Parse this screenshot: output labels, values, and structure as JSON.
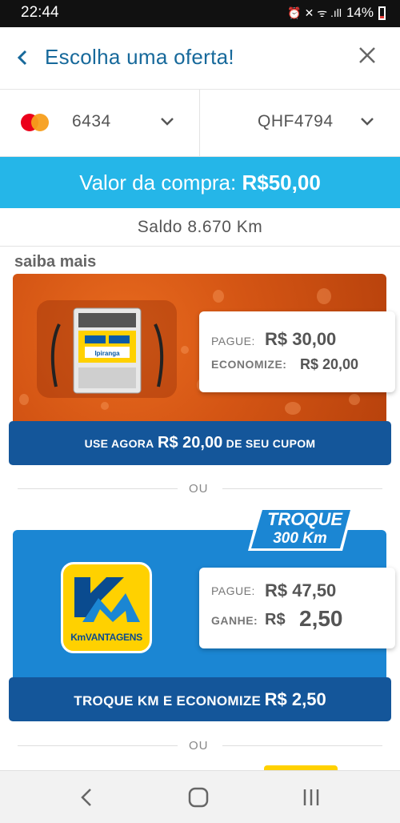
{
  "status": {
    "time": "22:44",
    "icons": "⏰ ✕ ᯤ .ıll",
    "battery": "14%"
  },
  "header": {
    "back_icon": "chevron-left-icon",
    "title": "Escolha uma oferta!",
    "close_icon": "close-icon"
  },
  "selectors": {
    "card_last_digits": "6434",
    "plate": "QHF4794"
  },
  "purchase": {
    "label": "Valor da compra:",
    "value": "R$50,00"
  },
  "balance": {
    "text": "Saldo 8.670 Km"
  },
  "saiba_mais": "saiba mais",
  "offer1": {
    "brand_label_1": "Ipiranga",
    "pague_label": "PAGUE:",
    "pague_value": "R$ 30,00",
    "economize_label": "ECONOMIZE:",
    "economize_value": "R$ 20,00",
    "cta_prefix": "USE AGORA",
    "cta_amount": "R$ 20,00",
    "cta_suffix": "DE SEU CUPOM"
  },
  "separator": "OU",
  "offer2": {
    "badge_line1": "TROQUE",
    "badge_line2": "300 Km",
    "logo_text": "KmVANTAGENS",
    "pague_label": "PAGUE:",
    "pague_value": "R$ 47,50",
    "ganhe_label": "GANHE:",
    "ganhe_currency": "R$",
    "ganhe_value": "2,50",
    "cta_prefix": "TROQUE KM E ECONOMIZE",
    "cta_amount": "R$ 2,50"
  },
  "colors": {
    "primary": "#17699b",
    "accent": "#25b6e8",
    "cta": "#14569a",
    "offer_blue": "#1b86d3",
    "orange": "#d45514",
    "yellow": "#ffd100"
  }
}
